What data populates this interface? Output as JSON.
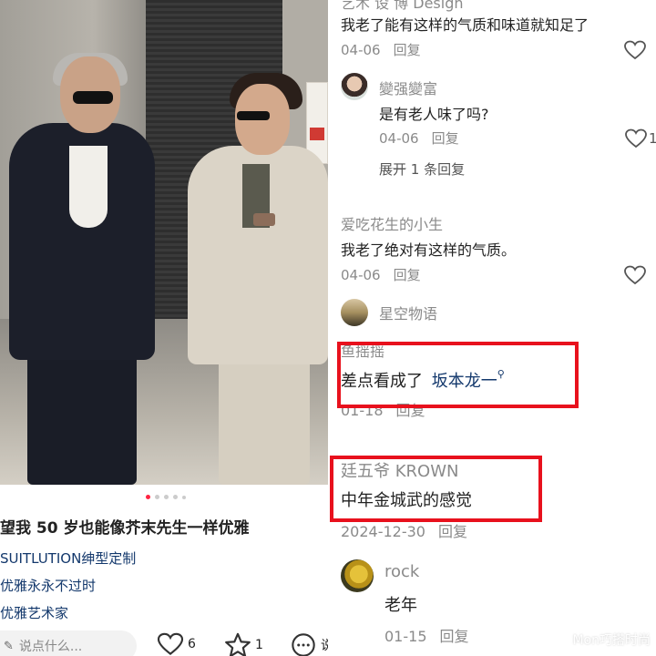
{
  "post": {
    "title": "望我 50 岁也能像芥末先生一样优雅",
    "tags": [
      "SUITLUTION绅型定制",
      "优雅永永不过时",
      "优雅艺术家"
    ],
    "carousel_count": 5,
    "carousel_active": 0
  },
  "bottom_bar": {
    "input_placeholder": "说点什么...",
    "likes": "6",
    "favorites": "1",
    "comment_label": "说"
  },
  "comments": {
    "c0": {
      "user": "艺术 设 博 Design",
      "text": "我老了能有这样的气质和味道就知足了",
      "date": "04-06",
      "reply": "回复"
    },
    "c1": {
      "user": "變强變富",
      "text": "是有老人味了吗?",
      "date": "04-06",
      "reply": "回复",
      "likes": "1"
    },
    "expand": "展开 1 条回复",
    "c2": {
      "user": "爱吃花生的小生",
      "text": "我老了绝对有这样的气质。",
      "date": "04-06",
      "reply": "回复"
    },
    "c3": {
      "user": "星空物语"
    },
    "c4": {
      "user": "鱼摇摇",
      "text_prefix": "差点看成了",
      "link": "坂本龙一",
      "date": "01-18",
      "reply": "回复"
    },
    "c5": {
      "user": "廷五爷 KROWN",
      "text": "中年金城武的感觉",
      "date": "2024-12-30",
      "reply": "回复"
    },
    "c6": {
      "user": "rock",
      "text": "老年",
      "date": "01-15",
      "reply": "回复"
    }
  },
  "watermark": "Mon巧搭时尚",
  "colors": {
    "highlight_box": "#e8111d",
    "link": "#13386c",
    "accent": "#ff2442"
  }
}
